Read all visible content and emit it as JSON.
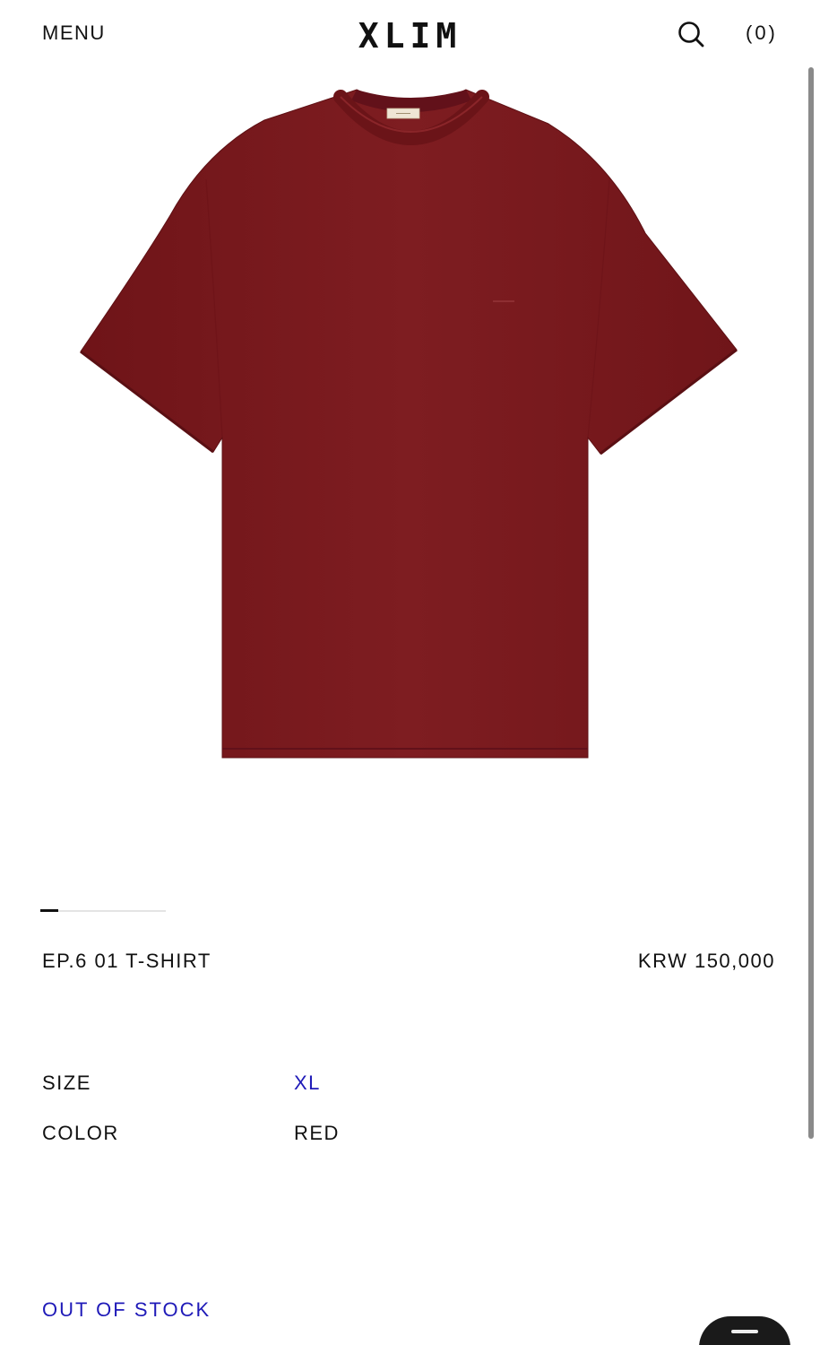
{
  "header": {
    "menu_label": "MENU",
    "logo": "XLIM",
    "cart_label": "(0)"
  },
  "icons": {
    "search": "search-icon",
    "chat": "chat-icon"
  },
  "gallery": {
    "image_alt": "Red t-shirt",
    "garment_color": "#7d1c20",
    "slide_index": 1
  },
  "product": {
    "name": "EP.6 01 T-SHIRT",
    "price": "KRW 150,000"
  },
  "options": {
    "size_label": "SIZE",
    "size_value": "XL",
    "color_label": "COLOR",
    "color_value": "RED"
  },
  "status": {
    "stock": "OUT OF STOCK"
  },
  "colors": {
    "accent": "#1f1ab8",
    "text": "#111111"
  }
}
